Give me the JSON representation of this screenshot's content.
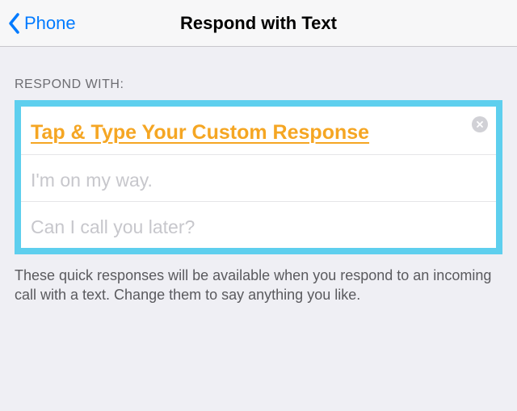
{
  "nav": {
    "back_label": "Phone",
    "title": "Respond with Text"
  },
  "section": {
    "header": "RESPOND WITH:"
  },
  "responses": {
    "custom_annotation": "Tap & Type Your Custom Response",
    "row2_placeholder": "I'm on my way.",
    "row3_placeholder": "Can I call you later?"
  },
  "footer": {
    "text": "These quick responses will be available when you respond to an incoming call with a text. Change them to say anything you like."
  },
  "colors": {
    "highlight_border": "#5ecfee",
    "annotation_orange": "#f5a623",
    "ios_blue": "#007aff"
  }
}
